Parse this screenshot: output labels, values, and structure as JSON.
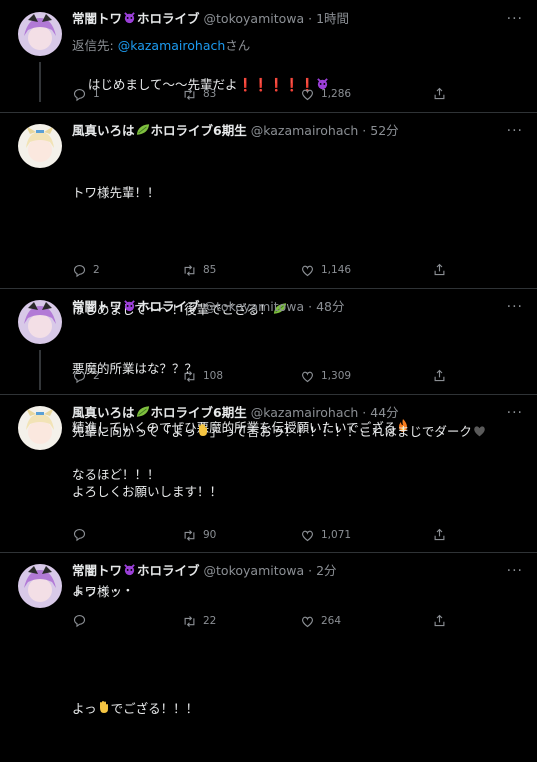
{
  "tweets": [
    {
      "name": "常闇トワ",
      "name_suffix": "ホロライブ",
      "name_emoji": "devil-icon",
      "handle": "@tokoyamitowa",
      "dot": "·",
      "time": "1時間",
      "reply_prefix": "返信先: ",
      "reply_handle": "@kazamairohach",
      "reply_suffix": "さん",
      "text": "はじめまして〜〜先輩だよ❗❗❗❗❗",
      "replies": "1",
      "retweets": "83",
      "likes": "1,286"
    },
    {
      "name": "風真いろは",
      "name_suffix": "ホロライブ6期生",
      "name_emoji": "leaf-icon",
      "handle": "@kazamairohach",
      "dot": "·",
      "time": "52分",
      "text_l1": "トワ様先輩！！",
      "text_l2": "はじめまして〜〜！後輩でござる！",
      "text_l3": "精進していくのでぜひ悪魔的所業を伝授願いたいでござる",
      "text_l4": "よろしくお願いします！！",
      "replies": "2",
      "retweets": "85",
      "likes": "1,146"
    },
    {
      "name": "常闇トワ",
      "name_suffix": "ホロライブ",
      "name_emoji": "devil-icon",
      "handle": "@tokoyamitowa",
      "dot": "·",
      "time": "48分",
      "text_l1": "悪魔的所業はな？？？",
      "text_l2a": "先輩に向かって「よっ",
      "text_l2b": "」って言おう！！！！！！これはまじでダーク",
      "replies": "2",
      "retweets": "108",
      "likes": "1,309"
    },
    {
      "name": "風真いろは",
      "name_suffix": "ホロライブ6期生",
      "name_emoji": "leaf-icon",
      "handle": "@kazamairohach",
      "dot": "·",
      "time": "44分",
      "text_l1": "なるほど！！！",
      "text_l2": "トワ様ッ",
      "text_l3a": "よっ",
      "text_l3b": "でござる！！！",
      "replies": "",
      "retweets": "90",
      "likes": "1,071"
    },
    {
      "name": "常闇トワ",
      "name_suffix": "ホロライブ",
      "name_emoji": "devil-icon",
      "handle": "@tokoyamitowa",
      "dot": "·",
      "time": "2分",
      "text": "よっ・・・",
      "replies": "",
      "retweets": "22",
      "likes": "264"
    }
  ],
  "colors": {
    "background": "#000000",
    "text": "#e7e9ea",
    "muted": "#8b8f94",
    "link": "#1d9bf0",
    "devil": "#9b3fd8",
    "leaf": "#7fbf3f"
  }
}
